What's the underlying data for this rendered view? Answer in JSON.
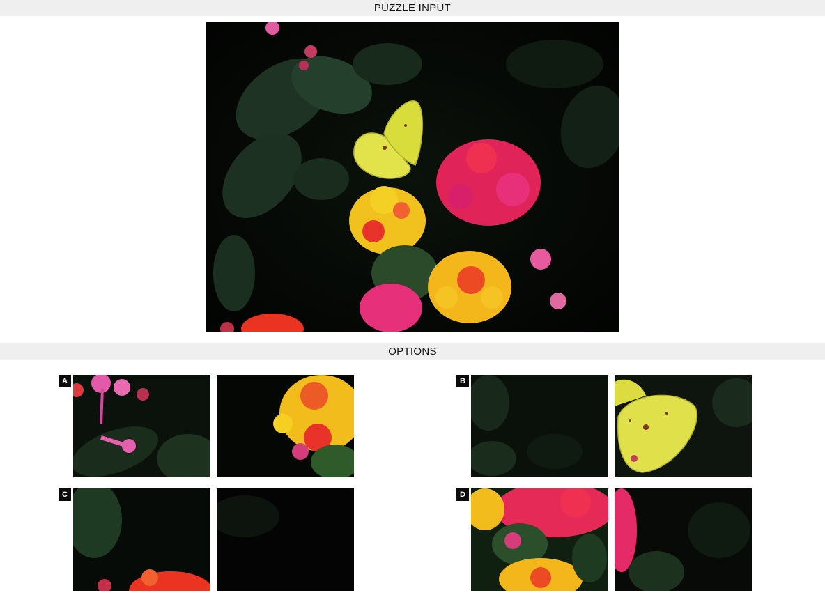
{
  "headers": {
    "puzzle_input": "PUZZLE INPUT",
    "options": "OPTIONS"
  },
  "puzzle": {
    "image_subject": "yellow butterfly on lantana flower cluster"
  },
  "options": [
    {
      "label": "A",
      "tiles": [
        "pink-flower-sprig-tile",
        "yellow-red-bloom-tile"
      ]
    },
    {
      "label": "B",
      "tiles": [
        "dark-leaves-tile",
        "butterfly-wing-tile"
      ]
    },
    {
      "label": "C",
      "tiles": [
        "red-flower-bottom-tile",
        "dark-background-tile"
      ]
    },
    {
      "label": "D",
      "tiles": [
        "lantana-cluster-tile",
        "pink-edge-tile"
      ]
    }
  ],
  "colors": {
    "header_bg": "#efefef",
    "badge_bg": "#0a0a0a",
    "badge_text": "#ffffff",
    "photo_bg": "#040604"
  }
}
